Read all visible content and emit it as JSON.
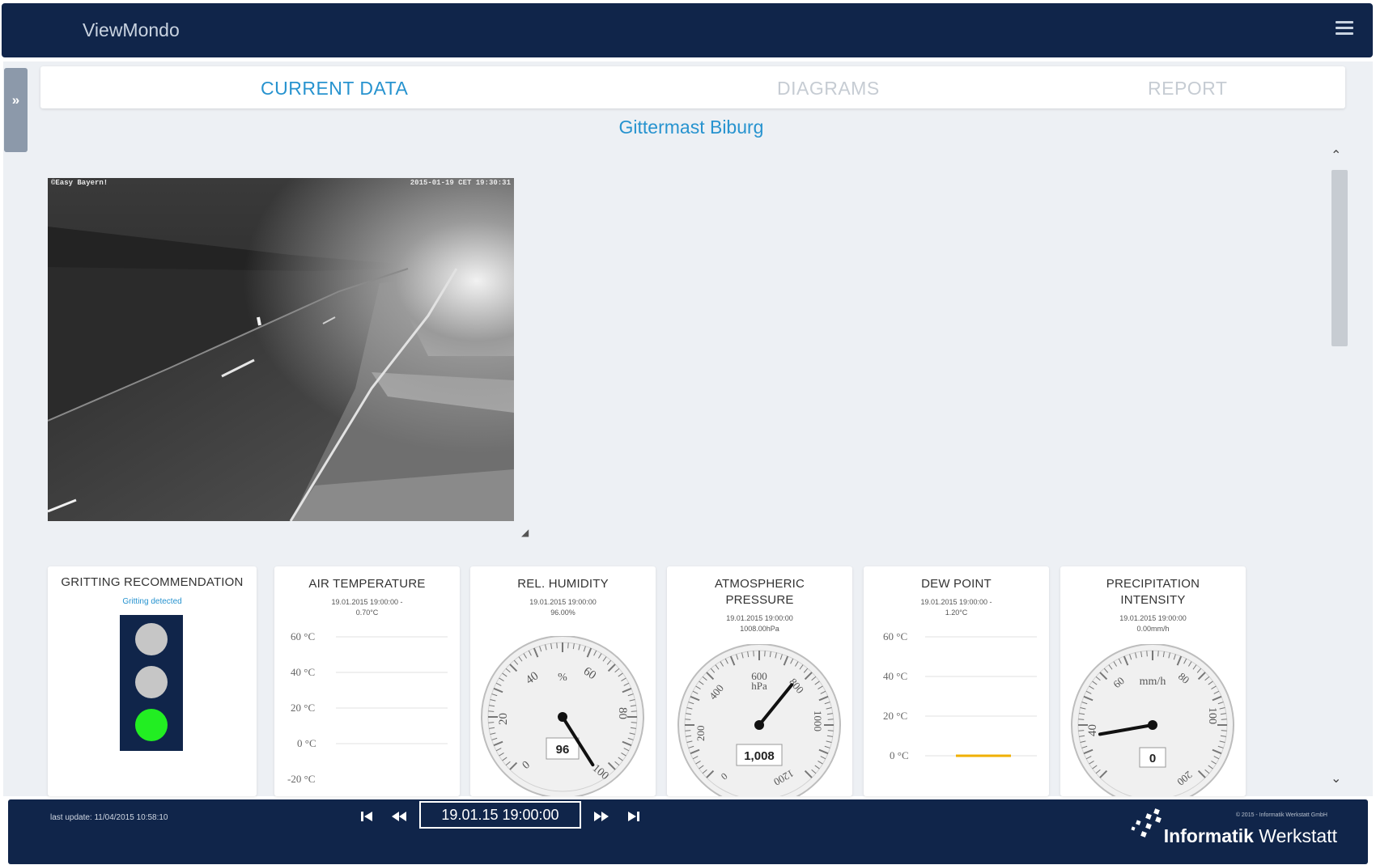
{
  "header": {
    "app_title": "ViewMondo",
    "menu_icon": "hamburger-menu-icon"
  },
  "sidebar_toggle": {
    "label": "»"
  },
  "tabs": [
    {
      "label": "CURRENT DATA",
      "active": true
    },
    {
      "label": "DIAGRAMS",
      "active": false
    },
    {
      "label": "REPORT",
      "active": false
    }
  ],
  "station": {
    "name": "Gittermast Biburg"
  },
  "camera": {
    "caption_left": "©Easy Bayern!",
    "caption_right": "2015-01-19 CET 19:30:31"
  },
  "cards": {
    "gritting": {
      "title": "GRITTING RECOMMENDATION",
      "status_text": "Gritting detected",
      "lights": {
        "top": "#c6c6c6",
        "middle": "#c6c6c6",
        "bottom": "#22ee22"
      }
    },
    "air_temperature": {
      "title": "AIR TEMPERATURE",
      "timestamp": "19.01.2015 19:00:00 -",
      "value": "0.70°C",
      "ticks": [
        "60 °C",
        "40 °C",
        "20 °C",
        "0 °C",
        "-20 °C"
      ]
    },
    "humidity": {
      "title": "REL. HUMIDITY",
      "timestamp": "19.01.2015 19:00:00",
      "value": "96.00%",
      "unit": "%",
      "labels": [
        "0",
        "20",
        "40",
        "60",
        "80",
        "100"
      ],
      "readout": "96",
      "gauge_value": 96,
      "range": [
        0,
        100
      ]
    },
    "pressure": {
      "title_line1": "ATMOSPHERIC",
      "title_line2": "PRESSURE",
      "timestamp": "19.01.2015 19:00:00",
      "value": "1008.00hPa",
      "unit_line1": "600",
      "unit_line2": "hPa",
      "labels": [
        "0",
        "200",
        "400",
        "800",
        "1000",
        "1200"
      ],
      "readout": "1,008",
      "gauge_value": 1008,
      "range": [
        0,
        1200
      ]
    },
    "dew_point": {
      "title": "DEW POINT",
      "timestamp": "19.01.2015 19:00:00 -",
      "value": "1.20°C",
      "ticks": [
        "60 °C",
        "40 °C",
        "20 °C",
        "0 °C"
      ],
      "line_color": "#f0b000"
    },
    "precipitation": {
      "title_line1": "PRECIPITATION",
      "title_line2": "INTENSITY",
      "timestamp": "19.01.2015 19:00:00",
      "value": "0.00mm/h",
      "unit": "mm/h",
      "labels": [
        "40",
        "60",
        "80",
        "100",
        "200"
      ],
      "readout": "0",
      "gauge_value": 0
    }
  },
  "footer": {
    "last_update": "last update: 11/04/2015 10:58:10",
    "datetime": "19.01.15 19:00:00",
    "copyright": "© 2015 - Informatik Werkstatt GmbH",
    "brand_bold": "Informatik",
    "brand_rest": "Werkstatt"
  }
}
